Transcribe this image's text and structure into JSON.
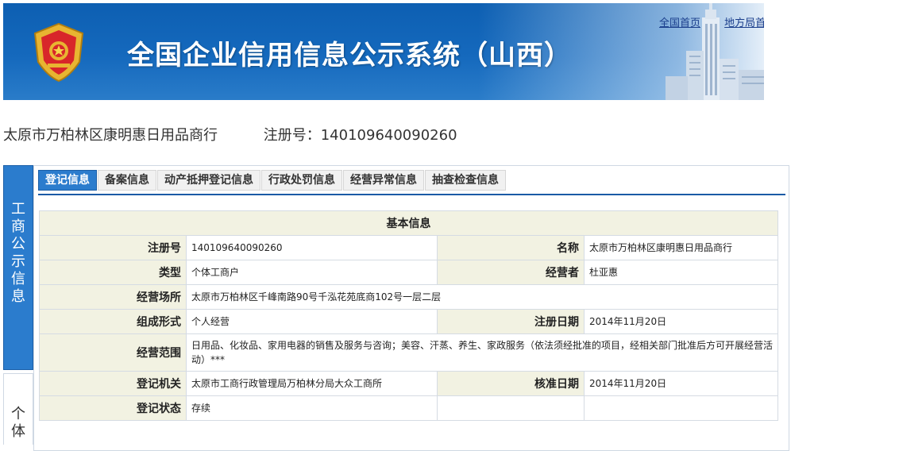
{
  "header": {
    "title": "全国企业信用信息公示系统（山西）",
    "links": [
      "全国首页",
      "地方局首页"
    ]
  },
  "company": {
    "name": "太原市万柏林区康明惠日用品商行",
    "reg_label": "注册号：",
    "reg_no": "140109640090260"
  },
  "side_tabs": [
    {
      "label": "工商公示信息",
      "active": true
    },
    {
      "label": "个体",
      "active": false
    }
  ],
  "tabs": [
    {
      "label": "登记信息",
      "active": true
    },
    {
      "label": "备案信息",
      "active": false
    },
    {
      "label": "动产抵押登记信息",
      "active": false
    },
    {
      "label": "行政处罚信息",
      "active": false
    },
    {
      "label": "经营异常信息",
      "active": false
    },
    {
      "label": "抽查检查信息",
      "active": false
    }
  ],
  "basic_info": {
    "section_title": "基本信息",
    "rows": [
      {
        "l1": "注册号",
        "v1": "140109640090260",
        "l2": "名称",
        "v2": "太原市万柏林区康明惠日用品商行"
      },
      {
        "l1": "类型",
        "v1": "个体工商户",
        "l2": "经营者",
        "v2": "杜亚惠"
      },
      {
        "l1": "经营场所",
        "v1": "太原市万柏林区千峰南路90号千泓花苑底商102号一层二层"
      },
      {
        "l1": "组成形式",
        "v1": "个人经营",
        "l2": "注册日期",
        "v2": "2014年11月20日"
      },
      {
        "l1": "经营范围",
        "v1": "日用品、化妆品、家用电器的销售及服务与咨询；美容、汗蒸、养生、家政服务（依法须经批准的项目，经相关部门批准后方可开展经营活动）***"
      },
      {
        "l1": "登记机关",
        "v1": "太原市工商行政管理局万柏林分局大众工商所",
        "l2": "核准日期",
        "v2": "2014年11月20日"
      },
      {
        "l1": "登记状态",
        "v1": "存续",
        "l2": "",
        "v2": ""
      }
    ]
  },
  "colors": {
    "banner_blue": "#1569bd",
    "tab_active": "#2b7ccd",
    "label_bg": "#f2f2e2",
    "link": "#1a3e8c"
  }
}
